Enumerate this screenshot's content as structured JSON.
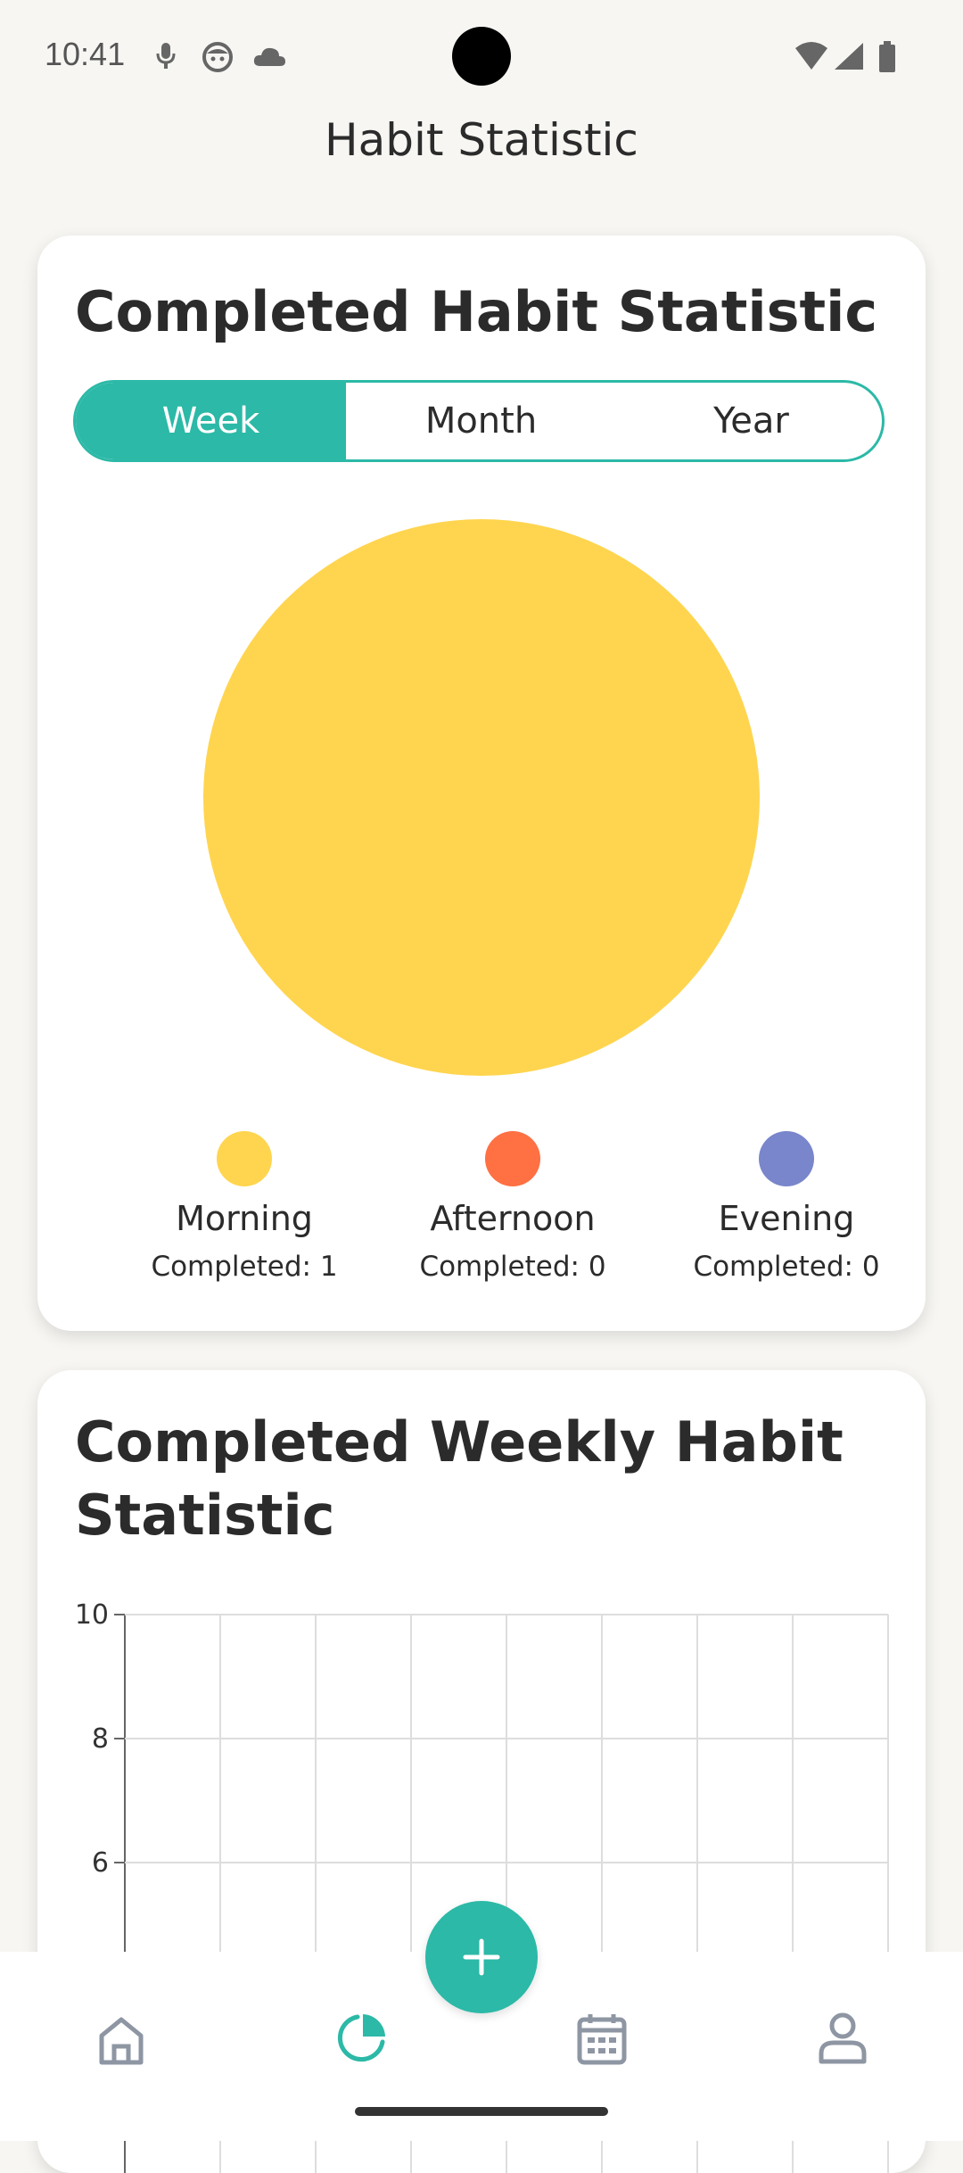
{
  "status_bar": {
    "time": "10:41",
    "icons": [
      "mic-icon",
      "face-icon",
      "cloud-icon",
      "wifi-icon",
      "signal-icon",
      "battery-icon"
    ]
  },
  "header": {
    "title": "Habit Statistic"
  },
  "completed_card": {
    "title": "Completed Habit Statistic",
    "tabs": [
      {
        "label": "Week",
        "selected": true
      },
      {
        "label": "Month",
        "selected": false
      },
      {
        "label": "Year",
        "selected": false
      }
    ],
    "legend": [
      {
        "label": "Morning",
        "count_text": "Completed: 1",
        "color": "#FFD54F"
      },
      {
        "label": "Afternoon",
        "count_text": "Completed: 0",
        "color": "#FF7043"
      },
      {
        "label": "Evening",
        "count_text": "Completed: 0",
        "color": "#7986CB"
      }
    ]
  },
  "weekly_card": {
    "title_line1": "Completed Weekly Habit",
    "title_line2": "Statistic"
  },
  "chart_data": [
    {
      "type": "pie",
      "categories": [
        "Morning",
        "Afternoon",
        "Evening"
      ],
      "values": [
        1,
        0,
        0
      ],
      "colors": [
        "#FFD54F",
        "#FF7043",
        "#7986CB"
      ],
      "title": "",
      "legend": "bottom"
    },
    {
      "type": "bar",
      "title": "",
      "yticks": [
        "10",
        "8",
        "6"
      ],
      "ylim_visible": [
        5,
        10
      ],
      "grid": true,
      "series": []
    }
  ],
  "bottom_nav": {
    "items": [
      "home-icon",
      "statistics-icon",
      "calendar-icon",
      "profile-icon"
    ],
    "active": "statistics-icon",
    "accent": "#2CB9A7",
    "inactive_color": "#8E96A3"
  }
}
